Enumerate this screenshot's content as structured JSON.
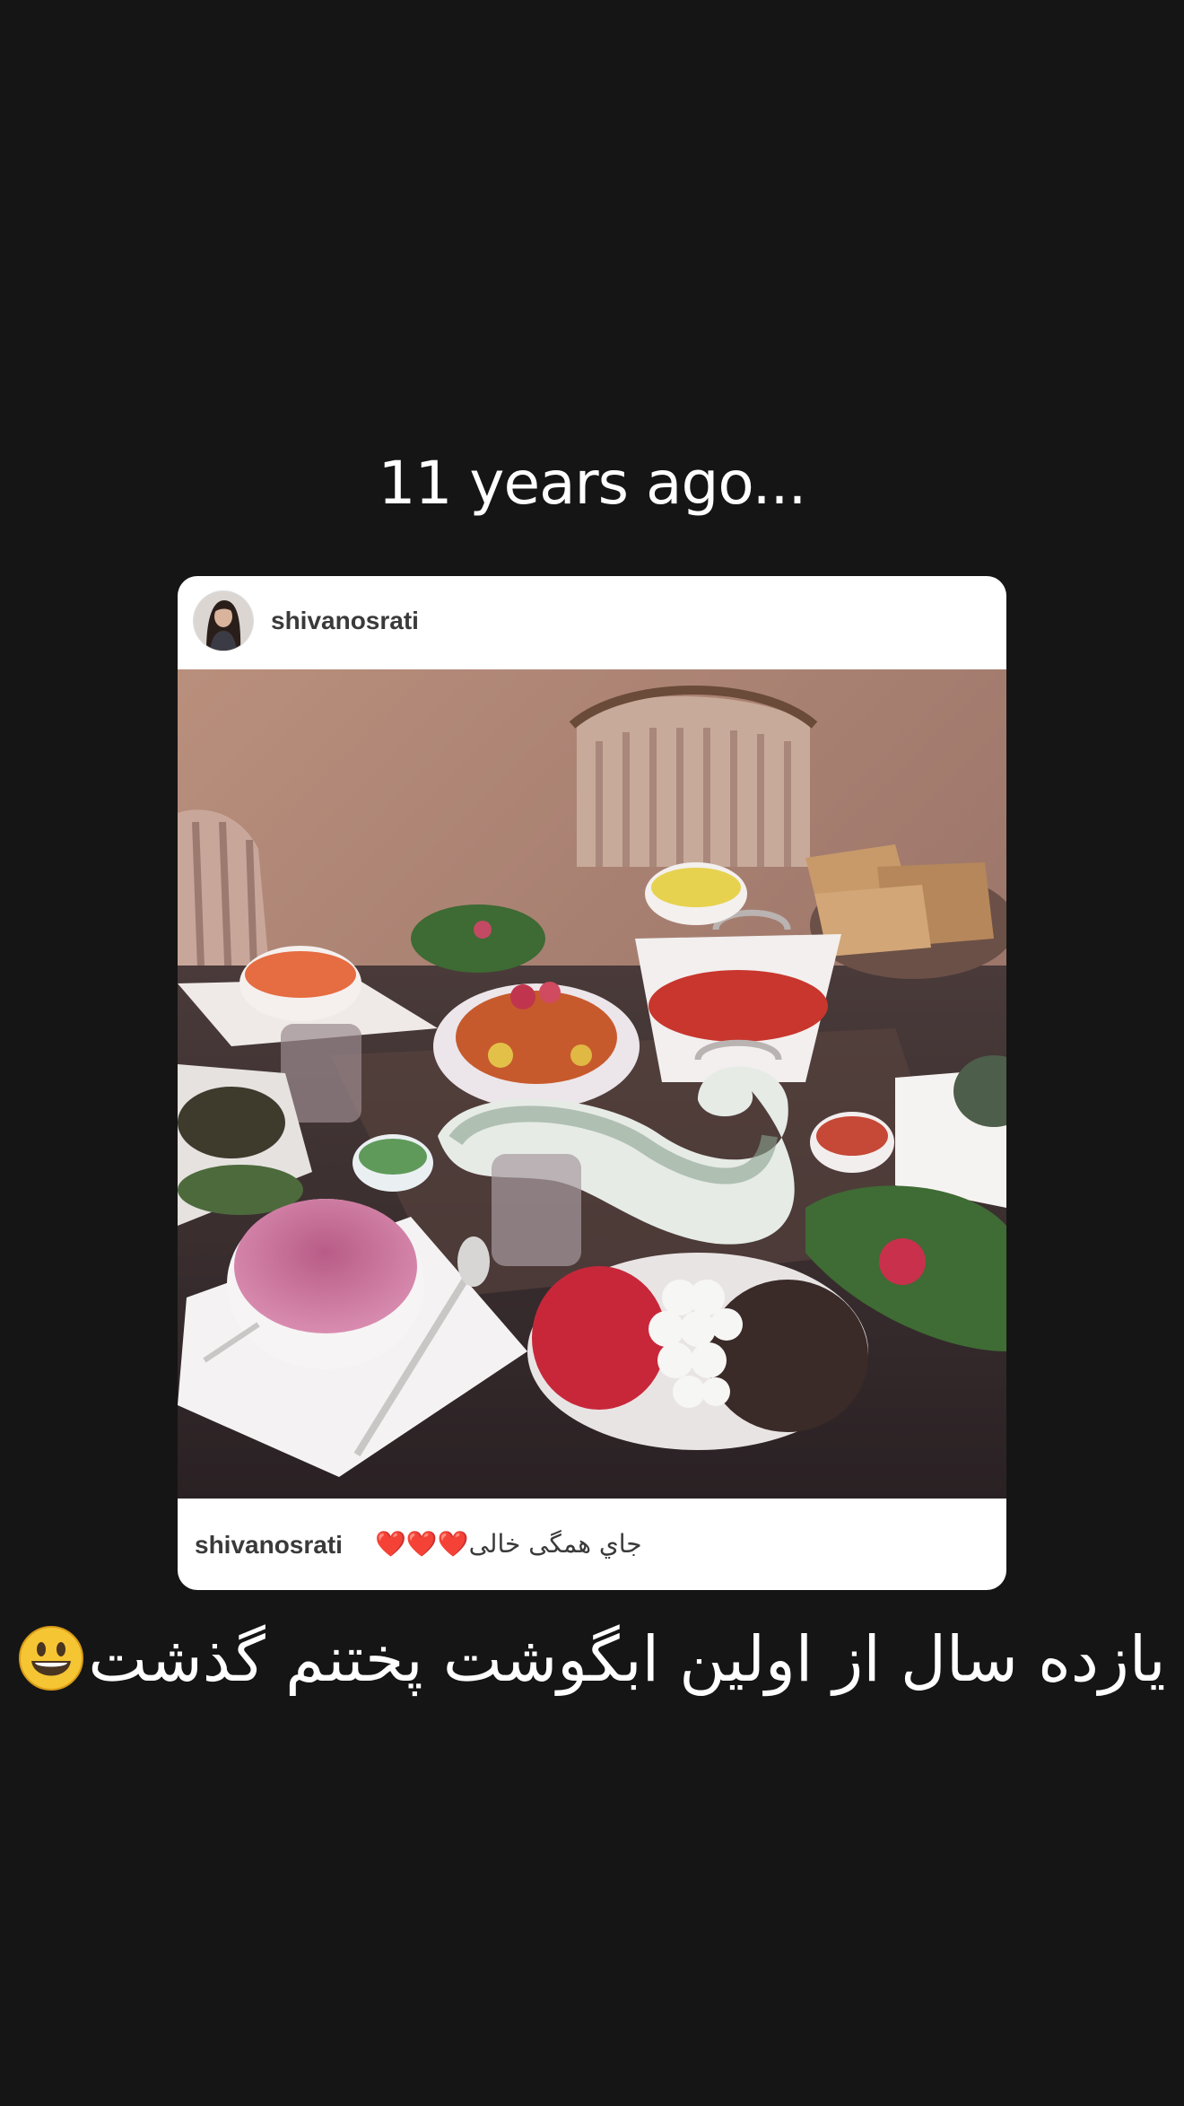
{
  "headline": "11 years ago...",
  "post": {
    "username": "shivanosrati",
    "caption_username": "shivanosrati",
    "caption_text": "جاي همگی خالی❤️❤️❤️"
  },
  "story_text": "یازده سال از اولین ابگوشت پختنم گذشت",
  "icons": {
    "emoji": "grinning-face-emoji",
    "hearts": "red-heart-emoji"
  },
  "colors": {
    "background": "#151515",
    "card": "#ffffff",
    "text_dark": "#3a3a3a",
    "heart": "#e0242e"
  }
}
